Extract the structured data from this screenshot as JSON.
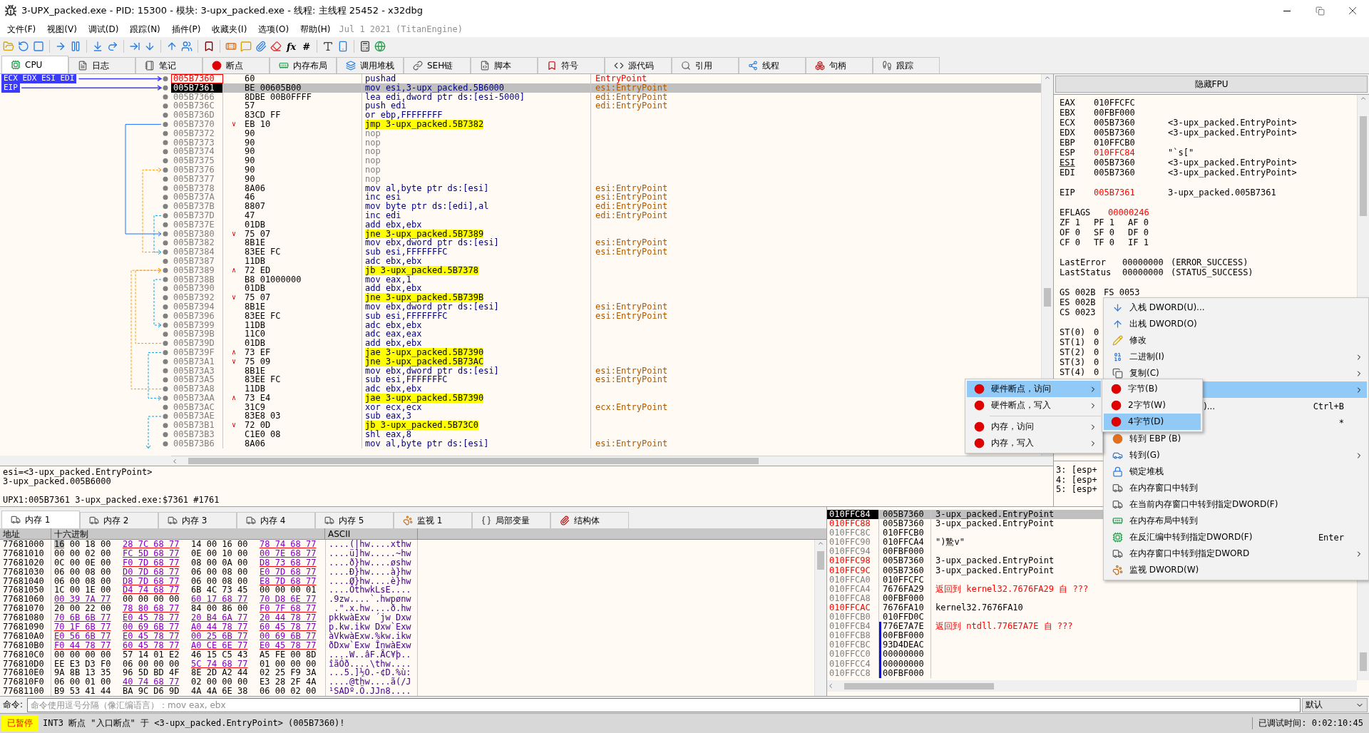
{
  "window": {
    "title": "3-UPX_packed.exe - PID: 15300 - 模块: 3-upx_packed.exe - 线程: 主线程 25452 - x32dbg"
  },
  "menu_bar": {
    "items": [
      "文件(F)",
      "视图(V)",
      "调试(D)",
      "跟踪(N)",
      "插件(P)",
      "收藏夹(I)",
      "选项(O)",
      "帮助(H)"
    ],
    "version": "Jul 1 2021 (TitanEngine)"
  },
  "toolbar": {
    "text_buttons": [
      "fx",
      "#"
    ]
  },
  "tabs": [
    {
      "label": "CPU",
      "selected": true
    },
    {
      "label": "日志",
      "selected": false
    },
    {
      "label": "笔记",
      "selected": false
    },
    {
      "label": "断点",
      "selected": false
    },
    {
      "label": "内存布局",
      "selected": false
    },
    {
      "label": "调用堆栈",
      "selected": false
    },
    {
      "label": "SEH链",
      "selected": false
    },
    {
      "label": "脚本",
      "selected": false
    },
    {
      "label": "符号",
      "selected": false
    },
    {
      "label": "源代码",
      "selected": false
    },
    {
      "label": "引用",
      "selected": false
    },
    {
      "label": "线程",
      "selected": false
    },
    {
      "label": "句柄",
      "selected": false
    },
    {
      "label": "跟踪",
      "selected": false
    }
  ],
  "disassembly": {
    "rows": [
      {
        "registers": "ECX EDX ESI EDI",
        "address": "005B7360",
        "bytes": "60",
        "instruction": "pushad",
        "comment": "EntryPoint",
        "kind": "normal",
        "selected": false,
        "breakpoint": true
      },
      {
        "registers": "EIP",
        "address": "005B7361",
        "bytes": "BE 00605B00",
        "instruction": "mov esi,3-upx_packed.5B6000",
        "comment": "esi:EntryPoint",
        "kind": "normal",
        "selected": true,
        "breakpoint": false
      },
      {
        "address": "005B7366",
        "bytes": "8DBE 00B0FFFF",
        "instruction": "lea edi,dword ptr ds:[esi-5000]",
        "comment": "edi:EntryPoint",
        "kind": "normal",
        "selected": false,
        "breakpoint": false
      },
      {
        "address": "005B736C",
        "bytes": "57",
        "instruction": "push edi",
        "comment": "edi:EntryPoint",
        "kind": "normal",
        "selected": false,
        "breakpoint": false
      },
      {
        "address": "005B736D",
        "bytes": "83CD FF",
        "instruction": "or ebp,FFFFFFFF",
        "kind": "normal",
        "selected": false,
        "breakpoint": false
      },
      {
        "address": "005B7370",
        "marker": "∨",
        "bytes": "EB 10",
        "instruction": "jmp 3-upx_packed.5B7382",
        "kind": "jump",
        "selected": false,
        "breakpoint": false
      },
      {
        "address": "005B7372",
        "bytes": "90",
        "instruction": "nop",
        "kind": "nop",
        "selected": false,
        "breakpoint": false
      },
      {
        "address": "005B7373",
        "bytes": "90",
        "instruction": "nop",
        "kind": "nop",
        "selected": false,
        "breakpoint": false
      },
      {
        "address": "005B7374",
        "bytes": "90",
        "instruction": "nop",
        "kind": "nop",
        "selected": false,
        "breakpoint": false
      },
      {
        "address": "005B7375",
        "bytes": "90",
        "instruction": "nop",
        "kind": "nop",
        "selected": false,
        "breakpoint": false
      },
      {
        "address": "005B7376",
        "bytes": "90",
        "instruction": "nop",
        "kind": "nop",
        "selected": false,
        "breakpoint": false
      },
      {
        "address": "005B7377",
        "bytes": "90",
        "instruction": "nop",
        "kind": "nop",
        "selected": false,
        "breakpoint": false
      },
      {
        "address": "005B7378",
        "bytes": "8A06",
        "instruction": "mov al,byte ptr ds:[esi]",
        "comment": "esi:EntryPoint",
        "kind": "normal",
        "selected": false,
        "breakpoint": false
      },
      {
        "address": "005B737A",
        "bytes": "46",
        "instruction": "inc esi",
        "comment": "esi:EntryPoint",
        "kind": "normal",
        "selected": false,
        "breakpoint": false
      },
      {
        "address": "005B737B",
        "bytes": "8807",
        "instruction": "mov byte ptr ds:[edi],al",
        "comment": "edi:EntryPoint",
        "kind": "normal",
        "selected": false,
        "breakpoint": false
      },
      {
        "address": "005B737D",
        "bytes": "47",
        "instruction": "inc edi",
        "comment": "edi:EntryPoint",
        "kind": "normal",
        "selected": false,
        "breakpoint": false
      },
      {
        "address": "005B737E",
        "bytes": "01DB",
        "instruction": "add ebx,ebx",
        "kind": "normal",
        "selected": false,
        "breakpoint": false
      },
      {
        "address": "005B7380",
        "marker": "∨",
        "bytes": "75 07",
        "instruction": "jne 3-upx_packed.5B7389",
        "kind": "jump",
        "selected": false,
        "breakpoint": false
      },
      {
        "address": "005B7382",
        "bytes": "8B1E",
        "instruction": "mov ebx,dword ptr ds:[esi]",
        "comment": "esi:EntryPoint",
        "kind": "normal",
        "selected": false,
        "breakpoint": false
      },
      {
        "address": "005B7384",
        "bytes": "83EE FC",
        "instruction": "sub esi,FFFFFFFC",
        "comment": "esi:EntryPoint",
        "kind": "normal",
        "selected": false,
        "breakpoint": false
      },
      {
        "address": "005B7387",
        "bytes": "11DB",
        "instruction": "adc ebx,ebx",
        "kind": "normal",
        "selected": false,
        "breakpoint": false
      },
      {
        "address": "005B7389",
        "marker": "∧",
        "bytes": "72 ED",
        "instruction": "jb 3-upx_packed.5B7378",
        "kind": "jump",
        "selected": false,
        "breakpoint": false
      },
      {
        "address": "005B738B",
        "bytes": "B8 01000000",
        "instruction": "mov eax,1",
        "kind": "normal",
        "selected": false,
        "breakpoint": false
      },
      {
        "address": "005B7390",
        "bytes": "01DB",
        "instruction": "add ebx,ebx",
        "kind": "normal",
        "selected": false,
        "breakpoint": false
      },
      {
        "address": "005B7392",
        "marker": "∨",
        "bytes": "75 07",
        "instruction": "jne 3-upx_packed.5B739B",
        "kind": "jump",
        "selected": false,
        "breakpoint": false
      },
      {
        "address": "005B7394",
        "bytes": "8B1E",
        "instruction": "mov ebx,dword ptr ds:[esi]",
        "comment": "esi:EntryPoint",
        "kind": "normal",
        "selected": false,
        "breakpoint": false
      },
      {
        "address": "005B7396",
        "bytes": "83EE FC",
        "instruction": "sub esi,FFFFFFFC",
        "comment": "esi:EntryPoint",
        "kind": "normal",
        "selected": false,
        "breakpoint": false
      },
      {
        "address": "005B7399",
        "bytes": "11DB",
        "instruction": "adc ebx,ebx",
        "kind": "normal",
        "selected": false,
        "breakpoint": false
      },
      {
        "address": "005B739B",
        "bytes": "11C0",
        "instruction": "adc eax,eax",
        "kind": "normal",
        "selected": false,
        "breakpoint": false
      },
      {
        "address": "005B739D",
        "bytes": "01DB",
        "instruction": "add ebx,ebx",
        "kind": "normal",
        "selected": false,
        "breakpoint": false
      },
      {
        "address": "005B739F",
        "marker": "∧",
        "bytes": "73 EF",
        "instruction": "jae 3-upx_packed.5B7390",
        "kind": "jump",
        "selected": false,
        "breakpoint": false
      },
      {
        "address": "005B73A1",
        "marker": "∨",
        "bytes": "75 09",
        "instruction": "jne 3-upx_packed.5B73AC",
        "kind": "jump",
        "selected": false,
        "breakpoint": false
      },
      {
        "address": "005B73A3",
        "bytes": "8B1E",
        "instruction": "mov ebx,dword ptr ds:[esi]",
        "comment": "esi:EntryPoint",
        "kind": "normal",
        "selected": false,
        "breakpoint": false
      },
      {
        "address": "005B73A5",
        "bytes": "83EE FC",
        "instruction": "sub esi,FFFFFFFC",
        "comment": "esi:EntryPoint",
        "kind": "normal",
        "selected": false,
        "breakpoint": false
      },
      {
        "address": "005B73A8",
        "bytes": "11DB",
        "instruction": "adc ebx,ebx",
        "kind": "normal",
        "selected": false,
        "breakpoint": false
      },
      {
        "address": "005B73AA",
        "marker": "∧",
        "bytes": "73 E4",
        "instruction": "jae 3-upx_packed.5B7390",
        "kind": "jump",
        "selected": false,
        "breakpoint": false
      },
      {
        "address": "005B73AC",
        "bytes": "31C9",
        "instruction": "xor ecx,ecx",
        "comment": "ecx:EntryPoint",
        "kind": "normal",
        "selected": false,
        "breakpoint": false
      },
      {
        "address": "005B73AE",
        "bytes": "83E8 03",
        "instruction": "sub eax,3",
        "kind": "normal",
        "selected": false,
        "breakpoint": false
      },
      {
        "address": "005B73B1",
        "marker": "∨",
        "bytes": "72 0D",
        "instruction": "jb 3-upx_packed.5B73C0",
        "kind": "jump",
        "selected": false,
        "breakpoint": false
      },
      {
        "address": "005B73B3",
        "bytes": "C1E0 08",
        "instruction": "shl eax,8",
        "kind": "normal",
        "selected": false,
        "breakpoint": false
      },
      {
        "address": "005B73B6",
        "bytes": "8A06",
        "instruction": "mov al,byte ptr ds:[esi]",
        "comment": "esi:EntryPoint",
        "kind": "normal",
        "selected": false,
        "breakpoint": false
      }
    ]
  },
  "info": {
    "lines": [
      "esi=<3-upx_packed.EntryPoint>",
      "3-upx_packed.005B6000"
    ],
    "location": "UPX1:005B7361 3-upx_packed.exe:$7361 #1761"
  },
  "registers": {
    "fpu_button": "隐藏FPU",
    "rows": [
      {
        "kind": "reg",
        "name": "EAX",
        "value": "010FFCFC",
        "changed": false,
        "underlined": false
      },
      {
        "kind": "reg",
        "name": "EBX",
        "value": "00FBF000",
        "changed": false,
        "underlined": false
      },
      {
        "kind": "reg",
        "name": "ECX",
        "value": "005B7360",
        "comment": "<3-upx_packed.EntryPoint>",
        "changed": false,
        "underlined": false
      },
      {
        "kind": "reg",
        "name": "EDX",
        "value": "005B7360",
        "comment": "<3-upx_packed.EntryPoint>",
        "changed": false,
        "underlined": false
      },
      {
        "kind": "reg",
        "name": "EBP",
        "value": "010FFCB0",
        "changed": false,
        "underlined": false
      },
      {
        "kind": "reg",
        "name": "ESP",
        "value": "010FFC84",
        "comment": "\"`s[\"",
        "changed": true,
        "underlined": false
      },
      {
        "kind": "reg",
        "name": "ESI",
        "value": "005B7360",
        "comment": "<3-upx_packed.EntryPoint>",
        "changed": false,
        "underlined": true
      },
      {
        "kind": "reg",
        "name": "EDI",
        "value": "005B7360",
        "comment": "<3-upx_packed.EntryPoint>",
        "changed": false,
        "underlined": false
      },
      {
        "kind": "blank"
      },
      {
        "kind": "reg",
        "name": "EIP",
        "value": "005B7361",
        "comment": "3-upx_packed.005B7361",
        "changed": true,
        "underlined": false
      },
      {
        "kind": "blank"
      },
      {
        "kind": "wide",
        "name": "EFLAGS",
        "value": "00000246",
        "changed": true
      },
      {
        "kind": "flags",
        "items": [
          {
            "name": "ZF",
            "value": "1"
          },
          {
            "name": "PF",
            "value": "1"
          },
          {
            "name": "AF",
            "value": "0"
          }
        ]
      },
      {
        "kind": "flags",
        "items": [
          {
            "name": "OF",
            "value": "0"
          },
          {
            "name": "SF",
            "value": "0"
          },
          {
            "name": "DF",
            "value": "0"
          }
        ]
      },
      {
        "kind": "flags",
        "items": [
          {
            "name": "CF",
            "value": "0"
          },
          {
            "name": "TF",
            "value": "0"
          },
          {
            "name": "IF",
            "value": "1"
          }
        ]
      },
      {
        "kind": "blank"
      },
      {
        "kind": "status",
        "name": "LastError",
        "value": "00000000",
        "comment": "(ERROR_SUCCESS)"
      },
      {
        "kind": "status",
        "name": "LastStatus",
        "value": "00000000",
        "comment": "(STATUS_SUCCESS)"
      },
      {
        "kind": "blank"
      },
      {
        "kind": "segments",
        "items": [
          {
            "name": "GS",
            "value": "002B"
          },
          {
            "name": "FS",
            "value": "0053"
          }
        ]
      },
      {
        "kind": "segments",
        "items": [
          {
            "name": "ES",
            "value": "002B"
          }
        ]
      },
      {
        "kind": "segments",
        "items": [
          {
            "name": "CS",
            "value": "0023"
          }
        ]
      },
      {
        "kind": "blank"
      },
      {
        "kind": "fpu",
        "name": "ST(0)",
        "value": "0"
      },
      {
        "kind": "fpu",
        "name": "ST(1)",
        "value": "0"
      },
      {
        "kind": "fpu",
        "name": "ST(2)",
        "value": "0"
      },
      {
        "kind": "fpu",
        "name": "ST(3)",
        "value": "0"
      },
      {
        "kind": "fpu",
        "name": "ST(4)",
        "value": "0"
      }
    ]
  },
  "call_args": {
    "lines": [
      "3: [esp+",
      "4: [esp+",
      "5: [esp+"
    ]
  },
  "memory": {
    "tabs": [
      {
        "label": "内存 1",
        "selected": true
      },
      {
        "label": "内存 2",
        "selected": false
      },
      {
        "label": "内存 3",
        "selected": false
      },
      {
        "label": "内存 4",
        "selected": false
      },
      {
        "label": "内存 5",
        "selected": false
      },
      {
        "label": "监视 1",
        "selected": false
      },
      {
        "label": "局部变量",
        "selected": false
      },
      {
        "label": "结构体",
        "selected": false
      }
    ],
    "columns": [
      "地址",
      "十六进制",
      "ASCII"
    ],
    "rows": [
      {
        "address": "77681000",
        "selected": true,
        "groups": [
          {
            "bytes": "16 00 18 00",
            "pointer": false
          },
          {
            "bytes": "28 7C 68 77",
            "pointer": true
          },
          {
            "bytes": "14 00 16 00",
            "pointer": false
          },
          {
            "bytes": "78 74 68 77",
            "pointer": true
          }
        ],
        "ascii": "....(|hw....xthw"
      },
      {
        "address": "77681010",
        "selected": false,
        "groups": [
          {
            "bytes": "00 00 02 00",
            "pointer": false
          },
          {
            "bytes": "FC 5D 68 77",
            "pointer": true
          },
          {
            "bytes": "0E 00 10 00",
            "pointer": false
          },
          {
            "bytes": "00 7E 68 77",
            "pointer": true
          }
        ],
        "ascii": "....ü]hw.....~hw"
      },
      {
        "address": "77681020",
        "selected": false,
        "groups": [
          {
            "bytes": "0C 00 0E 00",
            "pointer": false
          },
          {
            "bytes": "F0 7D 68 77",
            "pointer": true
          },
          {
            "bytes": "08 00 0A 00",
            "pointer": false
          },
          {
            "bytes": "D8 73 68 77",
            "pointer": true
          }
        ],
        "ascii": "....ð}hw....øshw"
      },
      {
        "address": "77681030",
        "selected": false,
        "groups": [
          {
            "bytes": "06 00 08 00",
            "pointer": false
          },
          {
            "bytes": "D0 7D 68 77",
            "pointer": true
          },
          {
            "bytes": "06 00 08 00",
            "pointer": false
          },
          {
            "bytes": "E0 7D 68 77",
            "pointer": true
          }
        ],
        "ascii": "....Ð}hw....à}hw"
      },
      {
        "address": "77681040",
        "selected": false,
        "groups": [
          {
            "bytes": "06 00 08 00",
            "pointer": false
          },
          {
            "bytes": "D8 7D 68 77",
            "pointer": true
          },
          {
            "bytes": "06 00 08 00",
            "pointer": false
          },
          {
            "bytes": "E8 7D 68 77",
            "pointer": true
          }
        ],
        "ascii": "....Ø}hw....è}hw"
      },
      {
        "address": "77681050",
        "selected": false,
        "groups": [
          {
            "bytes": "1C 00 1E 00",
            "pointer": false
          },
          {
            "bytes": "D4 74 68 77",
            "pointer": true
          },
          {
            "bytes": "6B 4C 73 45",
            "pointer": false
          },
          {
            "bytes": "00 00 00 01",
            "pointer": false
          }
        ],
        "ascii": "....ÔthwkLsE...."
      },
      {
        "address": "77681060",
        "selected": false,
        "groups": [
          {
            "bytes": "00 39 7A 77",
            "pointer": true
          },
          {
            "bytes": "00 00 00 00",
            "pointer": false
          },
          {
            "bytes": "60 17 68 77",
            "pointer": true
          },
          {
            "bytes": "70 D8 6E 77",
            "pointer": true
          }
        ],
        "ascii": ".9zw....`.hwpønw"
      },
      {
        "address": "77681070",
        "selected": false,
        "groups": [
          {
            "bytes": "20 00 22 00",
            "pointer": false
          },
          {
            "bytes": "78 80 68 77",
            "pointer": true
          },
          {
            "bytes": "84 00 86 00",
            "pointer": false
          },
          {
            "bytes": "F0 7F 68 77",
            "pointer": true
          }
        ],
        "ascii": " .\".x.hw....ð.hw"
      },
      {
        "address": "77681080",
        "selected": false,
        "groups": [
          {
            "bytes": "70 6B 6B 77",
            "pointer": true
          },
          {
            "bytes": "E0 45 78 77",
            "pointer": true
          },
          {
            "bytes": "20 B4 6A 77",
            "pointer": true
          },
          {
            "bytes": "20 44 78 77",
            "pointer": true
          }
        ],
        "ascii": "pkkwàExw ´jw Dxw"
      },
      {
        "address": "77681090",
        "selected": false,
        "groups": [
          {
            "bytes": "70 1F 6B 77",
            "pointer": true
          },
          {
            "bytes": "00 69 6B 77",
            "pointer": true
          },
          {
            "bytes": "A0 44 78 77",
            "pointer": true
          },
          {
            "bytes": "60 45 78 77",
            "pointer": true
          }
        ],
        "ascii": "p.kw.ikw Dxw`Exw"
      },
      {
        "address": "776810A0",
        "selected": false,
        "groups": [
          {
            "bytes": "E0 56 6B 77",
            "pointer": true
          },
          {
            "bytes": "E0 45 78 77",
            "pointer": true
          },
          {
            "bytes": "00 25 6B 77",
            "pointer": true
          },
          {
            "bytes": "00 69 6B 77",
            "pointer": true
          }
        ],
        "ascii": "àVkwàExw.%kw.ikw"
      },
      {
        "address": "776810B0",
        "selected": false,
        "groups": [
          {
            "bytes": "F0 44 78 77",
            "pointer": true
          },
          {
            "bytes": "60 45 78 77",
            "pointer": true
          },
          {
            "bytes": "A0 CE 6E 77",
            "pointer": true
          },
          {
            "bytes": "E0 45 78 77",
            "pointer": true
          }
        ],
        "ascii": "ðDxw`Exw ÎnwàExw"
      },
      {
        "address": "776810C0",
        "selected": false,
        "groups": [
          {
            "bytes": "00 00 00 00",
            "pointer": false
          },
          {
            "bytes": "57 14 01 E2",
            "pointer": false
          },
          {
            "bytes": "46 15 C5 43",
            "pointer": false
          },
          {
            "bytes": "A5 FE 00 8D",
            "pointer": false
          }
        ],
        "ascii": "....W..âF.ÅC¥þ.."
      },
      {
        "address": "776810D0",
        "selected": false,
        "groups": [
          {
            "bytes": "EE E3 D3 F0",
            "pointer": false
          },
          {
            "bytes": "06 00 00 00",
            "pointer": false
          },
          {
            "bytes": "5C 74 68 77",
            "pointer": true
          },
          {
            "bytes": "01 00 00 00",
            "pointer": false
          }
        ],
        "ascii": "îãÓð....\\thw...."
      },
      {
        "address": "776810E0",
        "selected": false,
        "groups": [
          {
            "bytes": "9A 8B 13 35",
            "pointer": false
          },
          {
            "bytes": "96 5D BD 4F",
            "pointer": false
          },
          {
            "bytes": "8E 2D A2 44",
            "pointer": false
          },
          {
            "bytes": "02 25 F9 3A",
            "pointer": false
          }
        ],
        "ascii": "...5.]½O.-¢D.%ù:"
      },
      {
        "address": "776810F0",
        "selected": false,
        "groups": [
          {
            "bytes": "06 00 01 00",
            "pointer": false
          },
          {
            "bytes": "40 74 68 77",
            "pointer": true
          },
          {
            "bytes": "02 00 00 00",
            "pointer": false
          },
          {
            "bytes": "E3 28 2F 4A",
            "pointer": false
          }
        ],
        "ascii": "....@thw....ã(/J"
      },
      {
        "address": "77681100",
        "selected": false,
        "groups": [
          {
            "bytes": "B9 53 41 44",
            "pointer": false
          },
          {
            "bytes": "BA 9C D6 9D",
            "pointer": false
          },
          {
            "bytes": "4A 4A 6E 38",
            "pointer": false
          },
          {
            "bytes": "06 00 02 00",
            "pointer": false
          }
        ],
        "ascii": "¹SADº.Ö.JJn8...."
      }
    ]
  },
  "stack": {
    "rows": [
      {
        "address": "010FFC84",
        "value": "005B7360",
        "comment": "3-upx_packed.EntryPoint",
        "selected": true,
        "highlighted": false,
        "return": false,
        "frame": false
      },
      {
        "address": "010FFC88",
        "value": "005B7360",
        "comment": "3-upx_packed.EntryPoint",
        "selected": false,
        "highlighted": true,
        "return": false,
        "frame": false
      },
      {
        "address": "010FFC8C",
        "value": "010FFCB0",
        "selected": false,
        "highlighted": false,
        "frame": false
      },
      {
        "address": "010FFC90",
        "value": "010FFCA4",
        "comment": "\")鷙v\"",
        "selected": false,
        "highlighted": false,
        "return": false,
        "frame": false
      },
      {
        "address": "010FFC94",
        "value": "00FBF000",
        "selected": false,
        "highlighted": false,
        "frame": false
      },
      {
        "address": "010FFC98",
        "value": "005B7360",
        "comment": "3-upx_packed.EntryPoint",
        "selected": false,
        "highlighted": true,
        "return": false,
        "frame": false
      },
      {
        "address": "010FFC9C",
        "value": "005B7360",
        "comment": "3-upx_packed.EntryPoint",
        "selected": false,
        "highlighted": true,
        "return": false,
        "frame": false
      },
      {
        "address": "010FFCA0",
        "value": "010FFCFC",
        "selected": false,
        "highlighted": false,
        "frame": false
      },
      {
        "address": "010FFCA4",
        "value": "7676FA29",
        "comment": "返回到 kernel32.7676FA29 自 ???",
        "selected": false,
        "highlighted": false,
        "return": true,
        "frame": false
      },
      {
        "address": "010FFCA8",
        "value": "00FBF000",
        "selected": false,
        "highlighted": false,
        "frame": false
      },
      {
        "address": "010FFCAC",
        "value": "7676FA10",
        "comment": "kernel32.7676FA10",
        "selected": false,
        "highlighted": true,
        "return": false,
        "frame": false
      },
      {
        "address": "010FFCB0",
        "value": "010FFD0C",
        "selected": false,
        "highlighted": false,
        "frame": false
      },
      {
        "address": "010FFCB4",
        "value": "776E7A7E",
        "comment": "返回到 ntdll.776E7A7E 自 ???",
        "selected": false,
        "highlighted": false,
        "return": true,
        "frame": true
      },
      {
        "address": "010FFCB8",
        "value": "00FBF000",
        "selected": false,
        "highlighted": false,
        "frame": true
      },
      {
        "address": "010FFCBC",
        "value": "93D4DEAC",
        "selected": false,
        "highlighted": false,
        "frame": true
      },
      {
        "address": "010FFCC0",
        "value": "00000000",
        "selected": false,
        "highlighted": false,
        "frame": true
      },
      {
        "address": "010FFCC4",
        "value": "00000000",
        "selected": false,
        "highlighted": false,
        "frame": true
      },
      {
        "address": "010FFCC8",
        "value": "00FBF000",
        "selected": false,
        "highlighted": false,
        "frame": true
      }
    ]
  },
  "stack_menu": {
    "items": [
      {
        "label": "入栈 DWORD(U)...",
        "kind": "normal",
        "submenu": false,
        "selected": false
      },
      {
        "label": "出栈 DWORD(O)",
        "kind": "normal",
        "submenu": false,
        "selected": false
      },
      {
        "label": "修改",
        "kind": "normal",
        "submenu": false,
        "selected": false
      },
      {
        "label": "二进制(I)",
        "kind": "normal",
        "submenu": true,
        "selected": false
      },
      {
        "label": "复制(C)",
        "kind": "normal",
        "submenu": true,
        "selected": false
      },
      {
        "kind": "covered",
        "submenu": true,
        "selected": true
      },
      {
        "label": ")...",
        "shortcut": "Ctrl+B",
        "kind": "covered",
        "submenu": false,
        "selected": false
      },
      {
        "shortcut": "*",
        "kind": "covered",
        "submenu": false,
        "selected": false
      },
      {
        "label": "转到 EBP (B)",
        "kind": "normal",
        "submenu": false,
        "selected": false
      },
      {
        "label": "转到(G)",
        "kind": "normal",
        "submenu": true,
        "selected": false
      },
      {
        "label": "锁定堆栈",
        "kind": "normal",
        "submenu": false,
        "selected": false
      },
      {
        "label": "在内存窗口中转到",
        "kind": "normal",
        "submenu": false,
        "selected": false
      },
      {
        "label": "在当前内存窗口中转到指定DWORD(F)",
        "kind": "normal",
        "submenu": false,
        "selected": false
      },
      {
        "label": "在内存布局中转到",
        "kind": "normal",
        "submenu": false,
        "selected": false
      },
      {
        "label": "在反汇编中转到指定DWORD(F)",
        "shortcut": "Enter",
        "kind": "normal",
        "submenu": false,
        "selected": false
      },
      {
        "label": "在内存窗口中转到指定DWORD",
        "kind": "normal",
        "submenu": true,
        "selected": false
      },
      {
        "label": "监视 DWORD(W)",
        "kind": "normal",
        "submenu": false,
        "selected": false
      }
    ]
  },
  "breakpoint_menu": {
    "items": [
      {
        "label": "硬件断点，访问",
        "kind": "normal",
        "submenu": true,
        "selected": true
      },
      {
        "label": "硬件断点，写入",
        "kind": "normal",
        "submenu": true,
        "selected": false
      },
      {
        "kind": "separator"
      },
      {
        "label": "内存，访问",
        "kind": "normal",
        "submenu": true,
        "selected": false
      },
      {
        "label": "内存，写入",
        "kind": "normal",
        "submenu": true,
        "selected": false
      }
    ]
  },
  "size_menu": {
    "items": [
      {
        "label": "字节(B)",
        "selected": false
      },
      {
        "label": "2字节(W)",
        "selected": false
      },
      {
        "label": "4字节(D)",
        "selected": true
      }
    ]
  },
  "command_bar": {
    "label": "命令:",
    "placeholder": "命令使用逗号分隔（像汇编语言）：mov eax, ebx",
    "mode": "默认"
  },
  "status_bar": {
    "state": "已暂停",
    "message": "INT3 断点 \"入口断点\" 于 <3-upx_packed.EntryPoint> (005B7360)!",
    "timer": "已调试时间: 0:02:10:45"
  }
}
